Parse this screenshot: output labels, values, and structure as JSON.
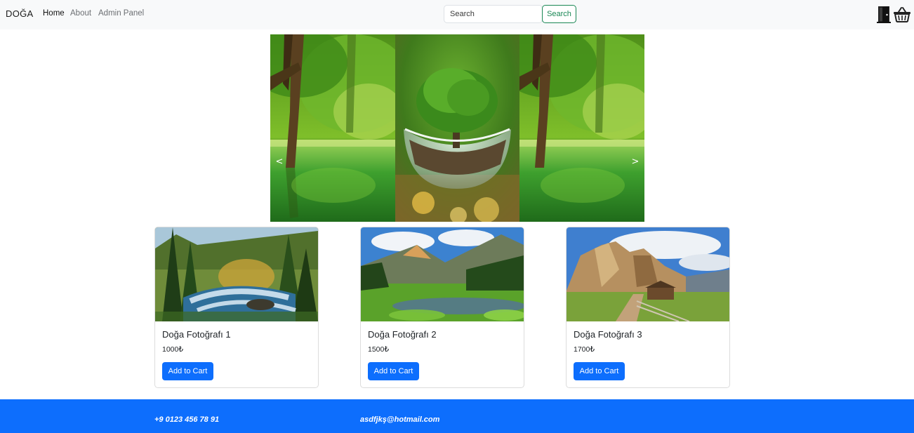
{
  "navbar": {
    "brand": "DOĞA",
    "links": [
      "Home",
      "About",
      "Admin Panel"
    ],
    "search": {
      "placeholder": "Search",
      "value": "",
      "button_label": "Search"
    },
    "icons": [
      "door-exit-icon",
      "shopping-basket-icon"
    ]
  },
  "carousel": {
    "prev_label": "<",
    "next_label": ">",
    "slides": [
      "forest-lake",
      "tree-in-glass-sphere",
      "forest-lake"
    ]
  },
  "products": [
    {
      "title": "Doğa Fotoğrafı 1",
      "price": "1000₺",
      "button": "Add to Cart",
      "image": "forest-waterfall"
    },
    {
      "title": "Doğa Fotoğrafı 2",
      "price": "1500₺",
      "button": "Add to Cart",
      "image": "mountain-pond-meadow"
    },
    {
      "title": "Doğa Fotoğrafı 3",
      "price": "1700₺",
      "button": "Add to Cart",
      "image": "rocky-mountain-cabin"
    }
  ],
  "footer": {
    "phone": "+9 0123 456 78 91",
    "email": "asdfjkş@hotmail.com"
  },
  "colors": {
    "navbar_bg": "#f8f9fa",
    "primary": "#0d6efd",
    "success": "#198754"
  }
}
